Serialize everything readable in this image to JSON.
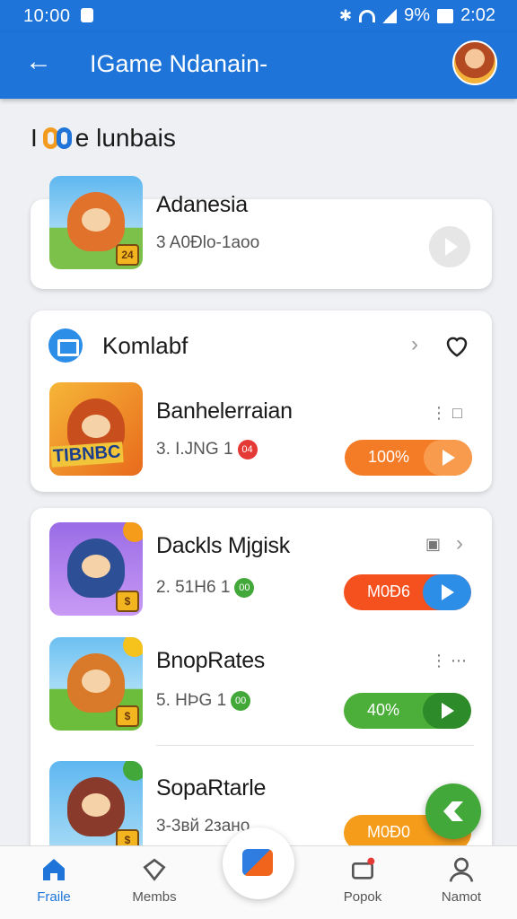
{
  "status_bar": {
    "time": "10:00",
    "battery": "9%",
    "clock_right": "2:02",
    "icons": [
      "bluetooth-icon",
      "wifi-icon",
      "signal-icon",
      "battery-icon"
    ]
  },
  "app_bar": {
    "title": "IGame Ndanain-",
    "back_icon": "arrow-left-icon",
    "avatar": "user-avatar"
  },
  "section": {
    "prefix": "I",
    "title": "e lunbais"
  },
  "featured": {
    "name": "Adanesia",
    "meta": "3 A0Ðlo-1aoo",
    "thumb_tag": "24"
  },
  "group": {
    "title": "Komlabf",
    "items": [
      {
        "name": "Banhelerraian",
        "meta": "3. I.JNG 1",
        "badge": "04",
        "progress_label": "100%",
        "progress": 1.0,
        "accent": "#f57c26",
        "thumb_text": "TIBNBC"
      },
      {
        "name": "Dackls Mjgisk",
        "meta": "2. 51Н6 1",
        "badge": "00",
        "progress_label": "M0Ð6",
        "progress": 0.75,
        "accent": "#f4511e",
        "go": "#2d8ee8"
      },
      {
        "name": "BnopRates",
        "meta": "5. HÞG 1",
        "badge": "00",
        "progress_label": "40%",
        "progress": 0.4,
        "accent": "#4caf3a"
      },
      {
        "name": "SopaRtarle",
        "meta": "3-3вй 2зано",
        "progress_label": "M0Ð0",
        "accent": "#f59c1a"
      }
    ]
  },
  "bottom_nav": [
    {
      "label": "Fraile",
      "icon": "home-icon",
      "active": true
    },
    {
      "label": "Membs",
      "icon": "tag-icon",
      "active": false
    },
    {
      "label": "Popok",
      "icon": "cart-icon",
      "active": false
    },
    {
      "label": "Namot",
      "icon": "profile-icon",
      "active": false
    }
  ],
  "colors": {
    "brand": "#1e74d9",
    "fab": "#43a83a"
  }
}
